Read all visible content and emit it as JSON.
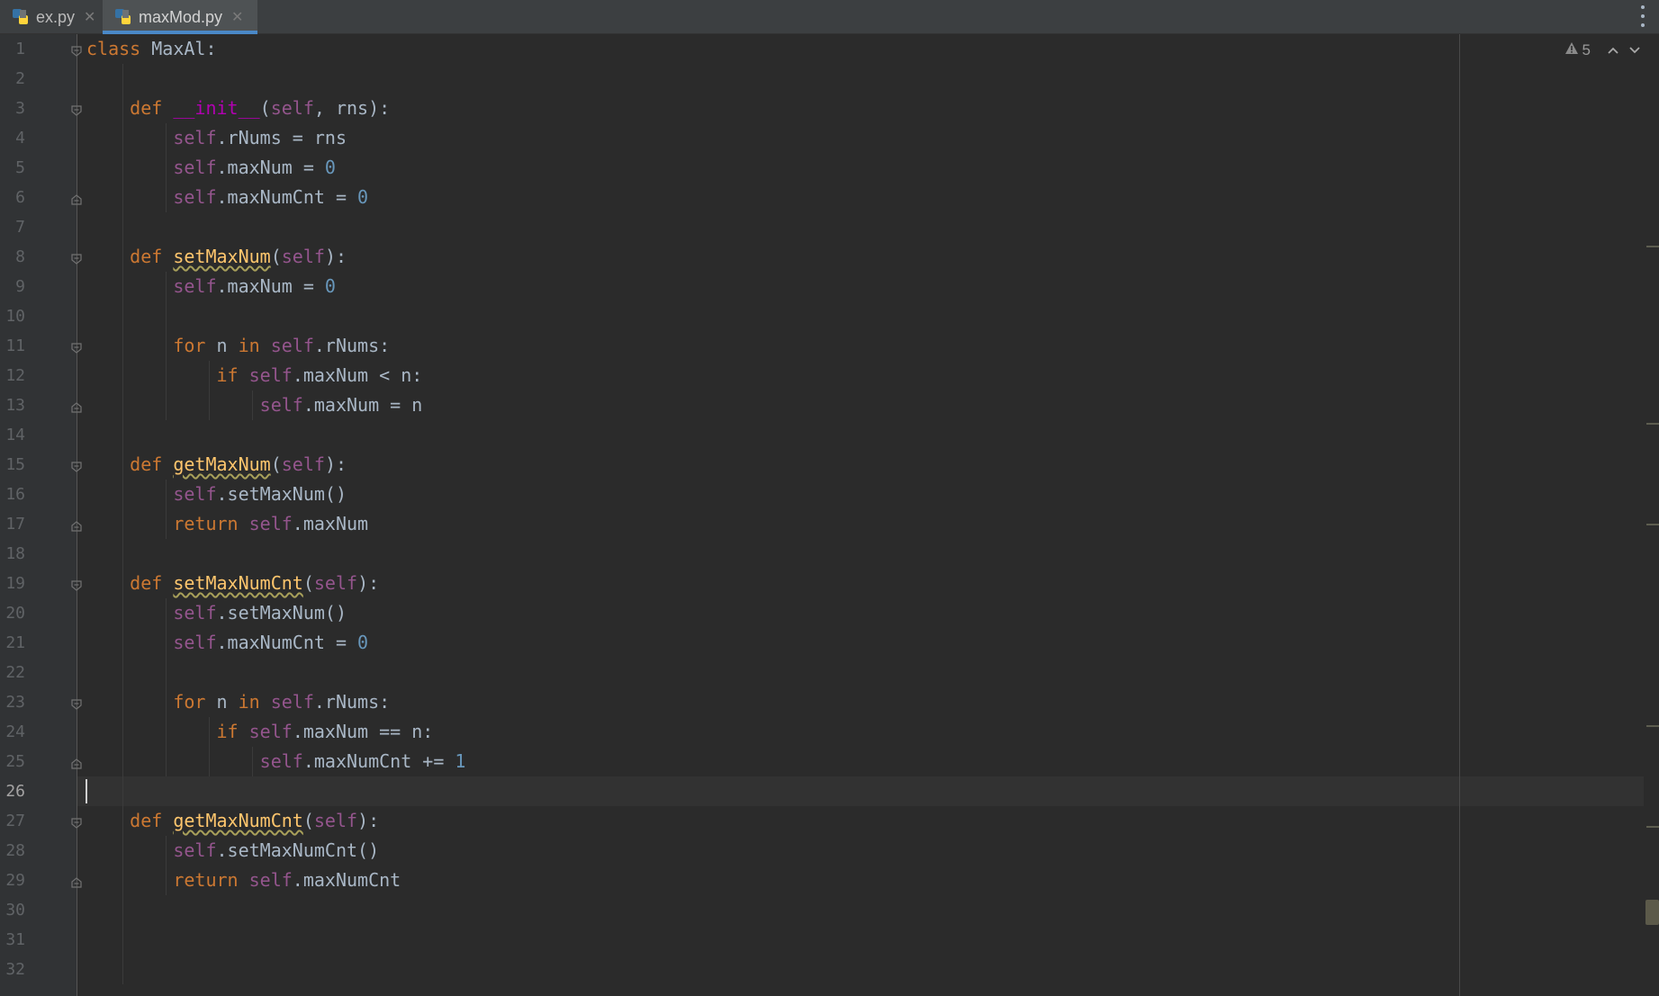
{
  "tabs": [
    {
      "label": "ex.py",
      "icon": "python-file-icon",
      "active": false
    },
    {
      "label": "maxMod.py",
      "icon": "python-file-icon",
      "active": true
    }
  ],
  "inspection": {
    "warning_count": "5",
    "icon": "warning-triangle-icon"
  },
  "editor": {
    "current_line": 26,
    "line_numbers": [
      "1",
      "2",
      "3",
      "4",
      "5",
      "6",
      "7",
      "8",
      "9",
      "10",
      "11",
      "12",
      "13",
      "14",
      "15",
      "16",
      "17",
      "18",
      "19",
      "20",
      "21",
      "22",
      "23",
      "24",
      "25",
      "26",
      "27",
      "28",
      "29",
      "30",
      "31",
      "32"
    ],
    "lines": [
      "class MaxAl:",
      "",
      "    def __init__(self, rns):",
      "        self.rNums = rns",
      "        self.maxNum = 0",
      "        self.maxNumCnt = 0",
      "",
      "    def setMaxNum(self):",
      "        self.maxNum = 0",
      "",
      "        for n in self.rNums:",
      "            if self.maxNum < n:",
      "                self.maxNum = n",
      "",
      "    def getMaxNum(self):",
      "        self.setMaxNum()",
      "        return self.maxNum",
      "",
      "    def setMaxNumCnt(self):",
      "        self.setMaxNum()",
      "        self.maxNumCnt = 0",
      "",
      "        for n in self.rNums:",
      "            if self.maxNum == n:",
      "                self.maxNumCnt += 1",
      "",
      "    def getMaxNumCnt(self):",
      "        self.setMaxNumCnt()",
      "        return self.maxNumCnt",
      "",
      "",
      ""
    ]
  },
  "colors": {
    "background": "#2b2b2b",
    "keyword": "#cc7832",
    "self": "#94558d",
    "number": "#6897bb",
    "function": "#ffc66d",
    "magic": "#b200b2",
    "text": "#a9b7c6",
    "tab_accent": "#4a88c7"
  }
}
